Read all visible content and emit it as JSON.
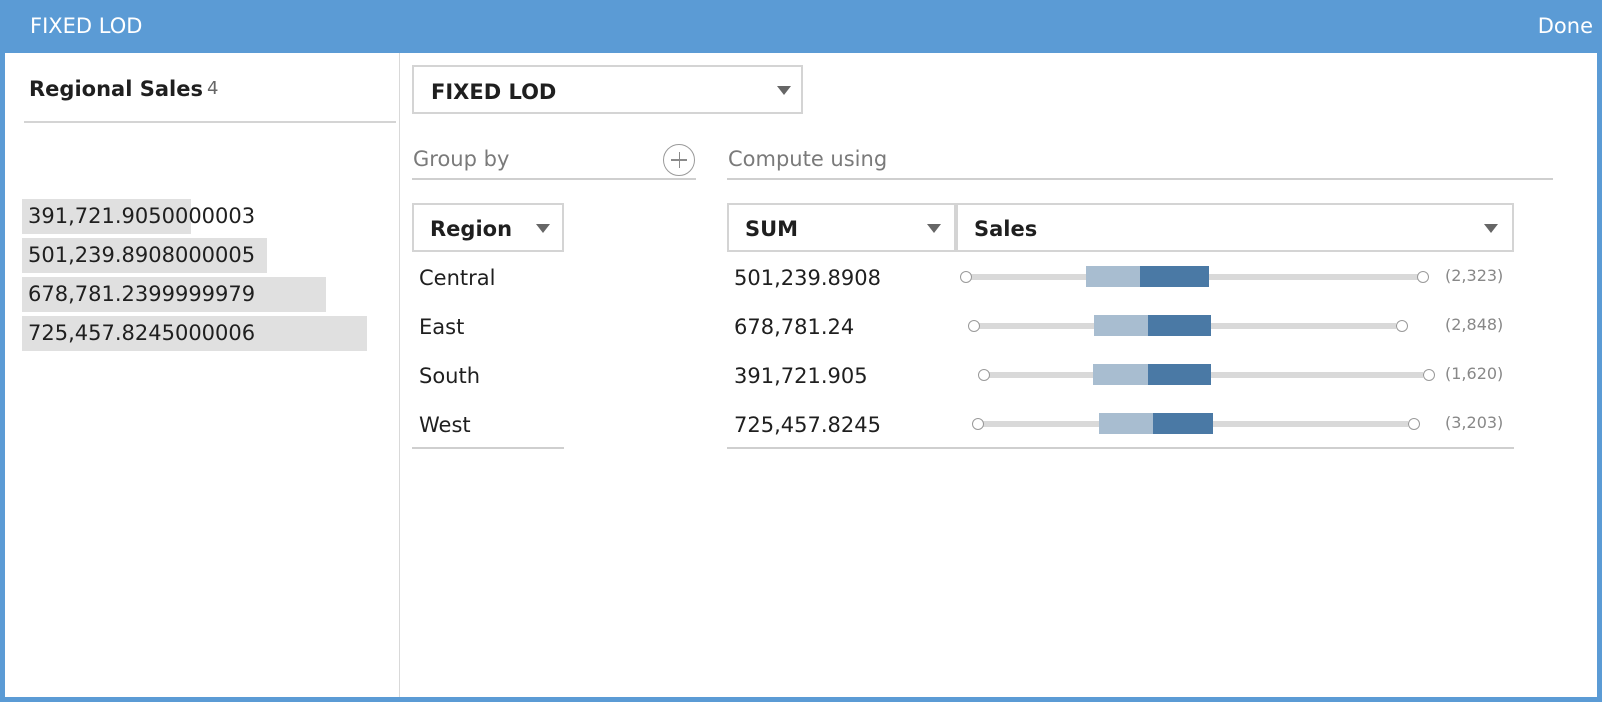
{
  "titlebar": {
    "title": "FIXED LOD",
    "done_label": "Done"
  },
  "field": {
    "name": "Regional Sales",
    "count": "4",
    "values": [
      {
        "label": "391,721.9050000003",
        "share": 0.49
      },
      {
        "label": "501,239.8908000005",
        "share": 0.71
      },
      {
        "label": "678,781.2399999979",
        "share": 0.88
      },
      {
        "label": "725,457.8245000006",
        "share": 1.0
      }
    ]
  },
  "calc_type": {
    "selected": "FIXED LOD"
  },
  "group_by": {
    "label": "Group by",
    "field": "Region",
    "rows": [
      "Central",
      "East",
      "South",
      "West"
    ]
  },
  "compute_using": {
    "label": "Compute using",
    "aggregation": "SUM",
    "measure": "Sales",
    "rows": [
      {
        "value": "501,239.8908",
        "count": "(2,323)"
      },
      {
        "value": "678,781.24",
        "count": "(2,848)"
      },
      {
        "value": "391,721.905",
        "count": "(1,620)"
      },
      {
        "value": "725,457.8245",
        "count": "(3,203)"
      }
    ]
  },
  "colors": {
    "titlebar": "#5b9bd5",
    "box_dark": "#4a79a5",
    "box_light": "#a8bdd0",
    "track": "#d9d9d9"
  },
  "icons": {
    "add": "plus-circle-icon",
    "dropdown": "caret-down-icon",
    "range_end": "circle-handle-icon"
  }
}
